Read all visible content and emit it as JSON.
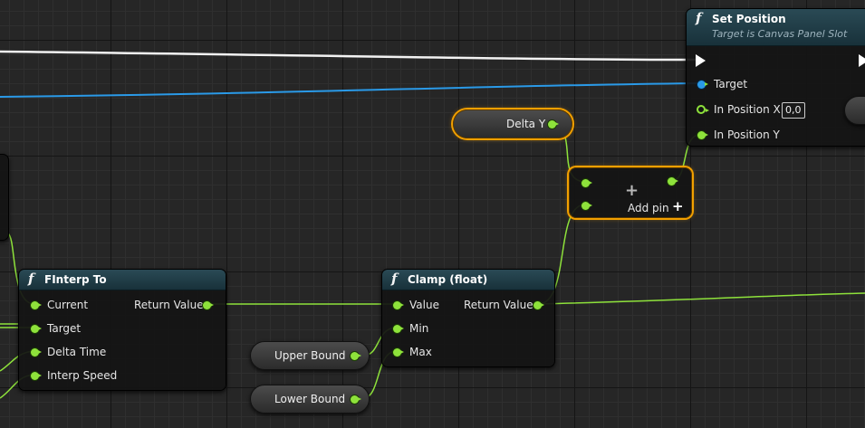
{
  "nodes": {
    "set_position": {
      "title": "Set Position",
      "subtitle": "Target is Canvas Panel Slot",
      "pins": {
        "target": "Target",
        "in_x": "In Position X",
        "in_x_value": "0,0",
        "in_y": "In Position Y"
      }
    },
    "finterp": {
      "title": "FInterp To",
      "pins": {
        "current": "Current",
        "target": "Target",
        "delta_time": "Delta Time",
        "interp_speed": "Interp Speed",
        "return_value": "Return Value"
      }
    },
    "clamp": {
      "title": "Clamp (float)",
      "pins": {
        "value": "Value",
        "min": "Min",
        "max": "Max",
        "return_value": "Return Value"
      }
    },
    "add": {
      "add_pin": "Add pin",
      "add_pin_glyph": "+",
      "center_glyph": "+"
    },
    "delta_y": {
      "label": "Delta Y"
    },
    "upper_bound": {
      "label": "Upper Bound"
    },
    "lower_bound": {
      "label": "Lower Bound"
    }
  },
  "icons": {
    "function": "f"
  },
  "colors": {
    "float_pin": "#8ee23b",
    "object_pin": "#2a9ae8",
    "exec_wire": "#ffffff",
    "selection": "#f2a000"
  }
}
